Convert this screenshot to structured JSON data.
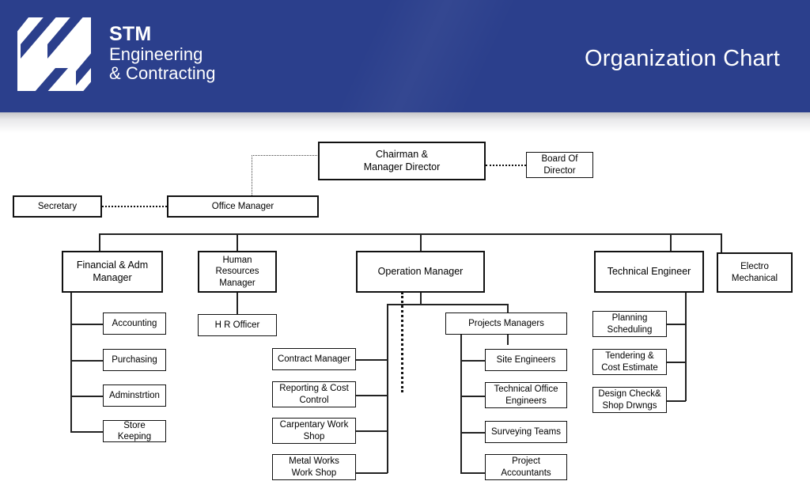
{
  "header": {
    "brand_line_1": "STM",
    "brand_line_2": "Engineering",
    "brand_line_3": "& Contracting",
    "title": "Organization Chart",
    "background_color": "#2b3f8c",
    "text_color": "#ffffff",
    "logo_icon": "stm-diagonal-stripes-logo"
  },
  "chart_data": {
    "type": "diagram",
    "title": "Organization Chart",
    "orientation": "top-down",
    "nodes": {
      "chairman": "Chairman &\nManager Director",
      "board_of_director": "Board Of\nDirector",
      "secretary": "Secretary",
      "office_manager": "Office Manager",
      "financial_manager": "Financial & Adm\nManager",
      "hr_manager": "Human\nResources\nManager",
      "operation_manager": "Operation Manager",
      "technical_engineer": "Technical Engineer",
      "electro_mechanical": "Electro\nMechanical",
      "accounting": "Accounting",
      "purchasing": "Purchasing",
      "adminstrtion": "Adminstrtion",
      "store_keeping": "Store Keeping",
      "hr_officer": "H R Officer",
      "contract_manager": "Contract Manager",
      "reporting_cost_control": "Reporting & Cost\nControl",
      "carpentary_work_shop": "Carpentary Work\nShop",
      "metal_works_work_shop": "Metal Works\nWork Shop",
      "projects_managers": "Projects Managers",
      "site_engineers": "Site Engineers",
      "technical_office_engineers": "Technical Office\nEngineers",
      "surveying_teams": "Surveying Teams",
      "project_accountants": "Project\nAccountants",
      "planning_scheduling": "Planning\nScheduling",
      "tendering_cost_estimate": "Tendering &\nCost Estimate",
      "design_check_shop_drwngs": "Design Check&\nShop Drwngs"
    },
    "edges": [
      {
        "from": "chairman",
        "to": "board_of_director",
        "style": "dotted"
      },
      {
        "from": "chairman",
        "to": "office_manager",
        "style": "dotted"
      },
      {
        "from": "office_manager",
        "to": "secretary",
        "style": "dotted"
      },
      {
        "from": "chairman",
        "to": "financial_manager",
        "style": "solid"
      },
      {
        "from": "chairman",
        "to": "hr_manager",
        "style": "solid"
      },
      {
        "from": "chairman",
        "to": "operation_manager",
        "style": "solid"
      },
      {
        "from": "chairman",
        "to": "technical_engineer",
        "style": "solid"
      },
      {
        "from": "chairman",
        "to": "electro_mechanical",
        "style": "solid"
      },
      {
        "from": "financial_manager",
        "to": "accounting",
        "style": "solid"
      },
      {
        "from": "financial_manager",
        "to": "purchasing",
        "style": "solid"
      },
      {
        "from": "financial_manager",
        "to": "adminstrtion",
        "style": "solid"
      },
      {
        "from": "financial_manager",
        "to": "store_keeping",
        "style": "solid"
      },
      {
        "from": "hr_manager",
        "to": "hr_officer",
        "style": "solid"
      },
      {
        "from": "operation_manager",
        "to": "contract_manager",
        "style": "solid"
      },
      {
        "from": "operation_manager",
        "to": "reporting_cost_control",
        "style": "solid"
      },
      {
        "from": "operation_manager",
        "to": "carpentary_work_shop",
        "style": "solid"
      },
      {
        "from": "operation_manager",
        "to": "metal_works_work_shop",
        "style": "solid"
      },
      {
        "from": "operation_manager",
        "to": "projects_managers",
        "style": "solid"
      },
      {
        "from": "projects_managers",
        "to": "site_engineers",
        "style": "solid"
      },
      {
        "from": "projects_managers",
        "to": "technical_office_engineers",
        "style": "solid"
      },
      {
        "from": "projects_managers",
        "to": "surveying_teams",
        "style": "solid"
      },
      {
        "from": "projects_managers",
        "to": "project_accountants",
        "style": "solid"
      },
      {
        "from": "technical_engineer",
        "to": "planning_scheduling",
        "style": "solid"
      },
      {
        "from": "technical_engineer",
        "to": "tendering_cost_estimate",
        "style": "solid"
      },
      {
        "from": "technical_engineer",
        "to": "design_check_shop_drwngs",
        "style": "solid"
      }
    ],
    "node_border_color": "#111111",
    "node_fill_color": "#ffffff",
    "connector_color": "#222222"
  }
}
